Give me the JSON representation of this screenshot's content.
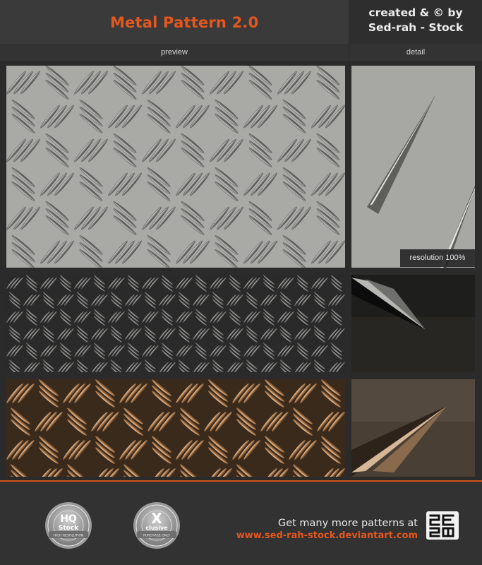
{
  "header": {
    "title": "Metal Pattern 2.0",
    "credit_line1": "created & © by",
    "credit_line2": "Sed-rah - Stock"
  },
  "labels": {
    "preview": "preview",
    "detail": "detail",
    "resolution": "resolution 100%"
  },
  "footer": {
    "line1": "Get many more patterns at",
    "line2": "www.sed-rah-stock.deviantart.com",
    "badge_hq": {
      "main": "HQ",
      "sub": "Stock",
      "ring": "HIGH RESOLUTION"
    },
    "badge_x": {
      "main": "X",
      "sub": "clusive",
      "ring": "PURCHASE ONLY"
    }
  },
  "colors": {
    "accent": "#e4571e",
    "silver_plate": "#a9a9a6",
    "black_plate": "#2a2a2a",
    "bronze_plate": "#3a2a1c"
  }
}
